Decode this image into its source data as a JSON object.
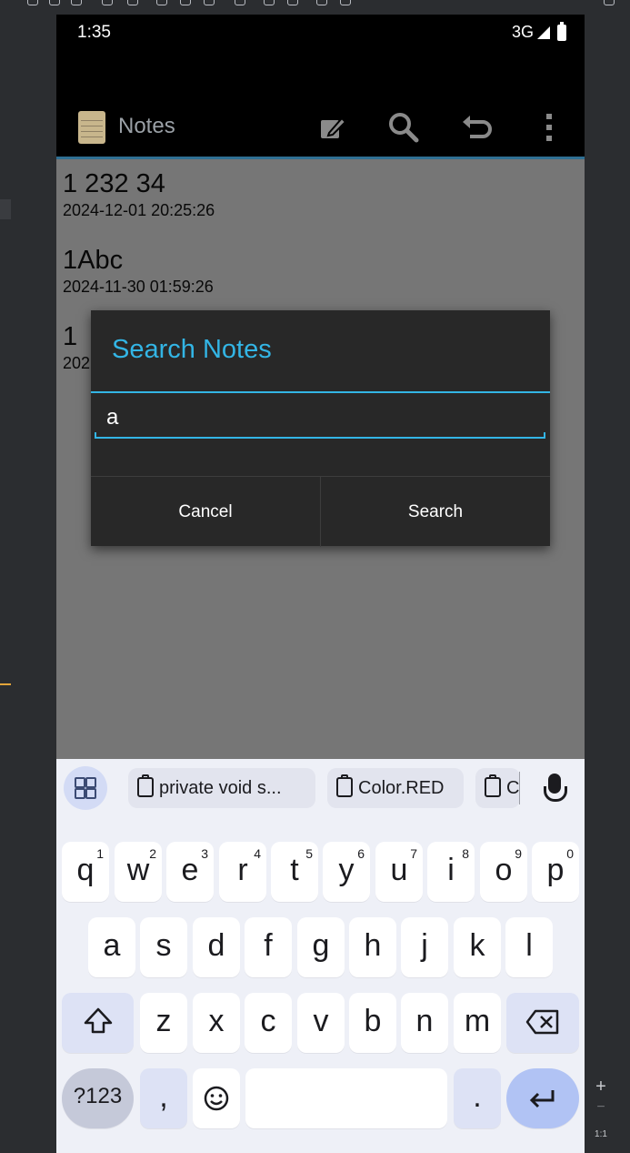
{
  "status_bar": {
    "time": "1:35",
    "network": "3G"
  },
  "action_bar": {
    "app_title": "Notes",
    "icons": [
      "note-edit-icon",
      "search-icon",
      "undo-icon",
      "overflow-menu-icon"
    ]
  },
  "notes": [
    {
      "title": "1 232 34",
      "date": "2024-12-01 20:25:26"
    },
    {
      "title": "1Abc",
      "date": "2024-11-30 01:59:26"
    },
    {
      "title": "1",
      "date": "202"
    }
  ],
  "dialog": {
    "title": "Search Notes",
    "input_value": "a",
    "cancel_label": "Cancel",
    "search_label": "Search"
  },
  "keyboard": {
    "suggestions": [
      "private void s...",
      "Color.RED",
      "C"
    ],
    "row1": [
      {
        "key": "q",
        "hint": "1"
      },
      {
        "key": "w",
        "hint": "2"
      },
      {
        "key": "e",
        "hint": "3"
      },
      {
        "key": "r",
        "hint": "4"
      },
      {
        "key": "t",
        "hint": "5"
      },
      {
        "key": "y",
        "hint": "6"
      },
      {
        "key": "u",
        "hint": "7"
      },
      {
        "key": "i",
        "hint": "8"
      },
      {
        "key": "o",
        "hint": "9"
      },
      {
        "key": "p",
        "hint": "0"
      }
    ],
    "row2": [
      "a",
      "s",
      "d",
      "f",
      "g",
      "h",
      "j",
      "k",
      "l"
    ],
    "row3": [
      "z",
      "x",
      "c",
      "v",
      "b",
      "n",
      "m"
    ],
    "sym_label": "?123",
    "comma": ",",
    "period": ".",
    "shift_icon": "shift-icon",
    "backspace_icon": "backspace-icon",
    "enter_icon": "enter-icon",
    "emoji_icon": "emoji-icon"
  },
  "host": {
    "zoom_plus": "+",
    "zoom_minus": "−",
    "zoom_ratio": "1:1"
  },
  "colors": {
    "accent": "#33b5e5",
    "dialog_bg": "#282828",
    "keyboard_bg": "#eef0f7"
  }
}
